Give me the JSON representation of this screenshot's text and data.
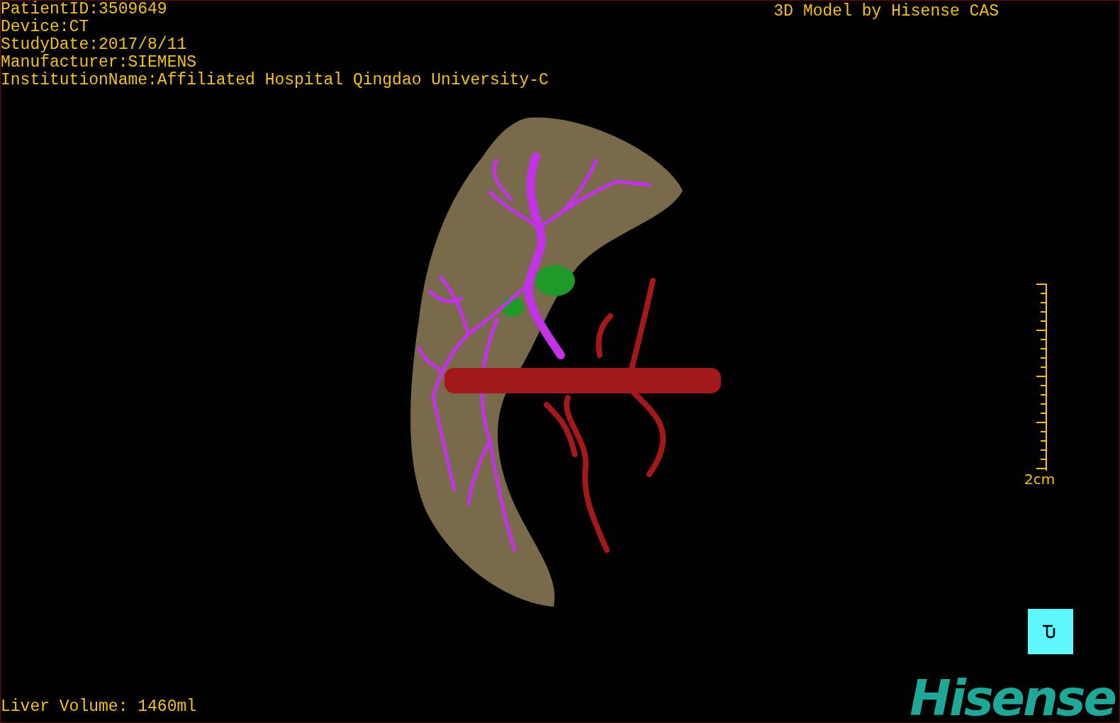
{
  "info": [
    "PatientID:3509649",
    "Device:CT",
    "StudyDate:2017/8/11",
    "Manufacturer:SIEMENS",
    "InstitutionName:Affiliated Hospital Qingdao University-C"
  ],
  "title": "3D Model by Hisense CAS",
  "scale_bar": {
    "label": "2cm"
  },
  "footer": {
    "volume": "Liver Volume: 1460ml"
  },
  "logo": "Hisense"
}
